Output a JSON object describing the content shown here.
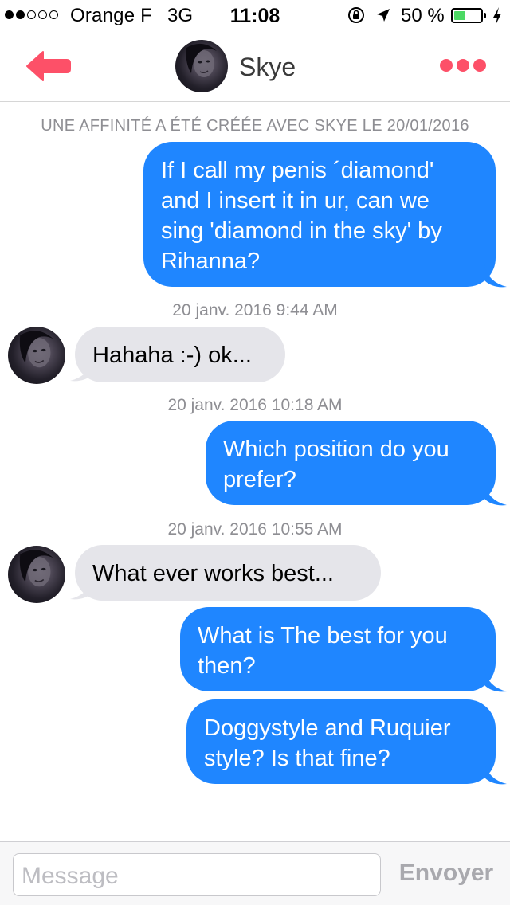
{
  "status_bar": {
    "carrier": "Orange F",
    "network": "3G",
    "time": "11:08",
    "battery_percent": "50 %",
    "battery_level": 0.5,
    "signal_bars": 2,
    "signal_total": 5,
    "battery_color": "#4cd964"
  },
  "nav": {
    "contact_name": "Skye",
    "back_icon": "back-arrow-icon",
    "more_icon": "more-dots-icon",
    "accent_color": "#fd5068"
  },
  "conversation": {
    "match_notice": "UNE AFFINITÉ A ÉTÉ CRÉÉE AVEC SKYE LE 20/01/2016",
    "timestamps": [
      "20 janv. 2016 9:44 AM",
      "20 janv. 2016 10:18 AM",
      "20 janv. 2016 10:55 AM"
    ],
    "messages": [
      {
        "from": "me",
        "text": "If I call my penis ´diamond' and I insert it in ur, can we sing 'diamond in the sky' by Rihanna?"
      },
      {
        "from": "them",
        "text": "Hahaha :-) ok..."
      },
      {
        "from": "me",
        "text": "Which position do you prefer?"
      },
      {
        "from": "them",
        "text": "What ever works best..."
      },
      {
        "from": "me",
        "text": "What is The best for you then?"
      },
      {
        "from": "me",
        "text": "Doggystyle and Ruquier style? Is that fine?"
      }
    ],
    "outgoing_color": "#1f86ff",
    "incoming_color": "#e5e5ea"
  },
  "composer": {
    "placeholder": "Message",
    "value": "",
    "send_label": "Envoyer"
  }
}
